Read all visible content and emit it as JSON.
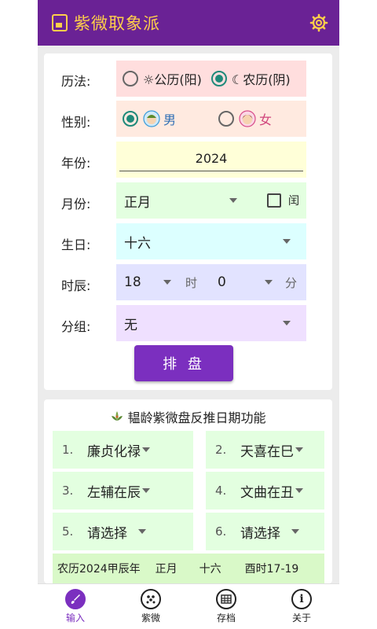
{
  "app": {
    "title": "紫微取象派"
  },
  "form": {
    "calendar": {
      "label": "历法:",
      "solar": "☼公历(阳)",
      "lunar": "☾农历(阴)",
      "selected": "lunar"
    },
    "gender": {
      "label": "性别:",
      "male": "男",
      "female": "女",
      "selected": "male"
    },
    "year": {
      "label": "年份:",
      "value": "2024"
    },
    "month": {
      "label": "月份:",
      "value": "正月",
      "leap_label": "闰"
    },
    "birthday": {
      "label": "生日:",
      "value": "十六"
    },
    "hour": {
      "label": "时辰:",
      "hour_value": "18",
      "hour_unit": "时",
      "minute_value": "0",
      "minute_unit": "分"
    },
    "group": {
      "label": "分组:",
      "value": "无"
    },
    "submit_label": "排 盘"
  },
  "reverse": {
    "title": "韫龄紫微盘反推日期功能",
    "slots": [
      {
        "num": "1.",
        "value": "廉贞化禄"
      },
      {
        "num": "2.",
        "value": "天喜在巳"
      },
      {
        "num": "3.",
        "value": "左辅在辰"
      },
      {
        "num": "4.",
        "value": "文曲在丑"
      },
      {
        "num": "5.",
        "value": "请选择"
      },
      {
        "num": "6.",
        "value": "请选择"
      }
    ],
    "result": {
      "year": "农历2024甲辰年",
      "month": "正月",
      "day": "十六",
      "hour": "酉时17-19"
    }
  },
  "nav": [
    {
      "label": "输入",
      "icon": "brush-icon",
      "active": true
    },
    {
      "label": "紫微",
      "icon": "dots-circle-icon",
      "active": false
    },
    {
      "label": "存档",
      "icon": "archive-icon",
      "active": false
    },
    {
      "label": "关于",
      "icon": "info-icon",
      "active": false
    }
  ],
  "colors": {
    "appbar": "#6a2295",
    "accent": "#7b2fbf",
    "title": "#ffcf4a",
    "radio_checked": "#1f8a7a"
  }
}
